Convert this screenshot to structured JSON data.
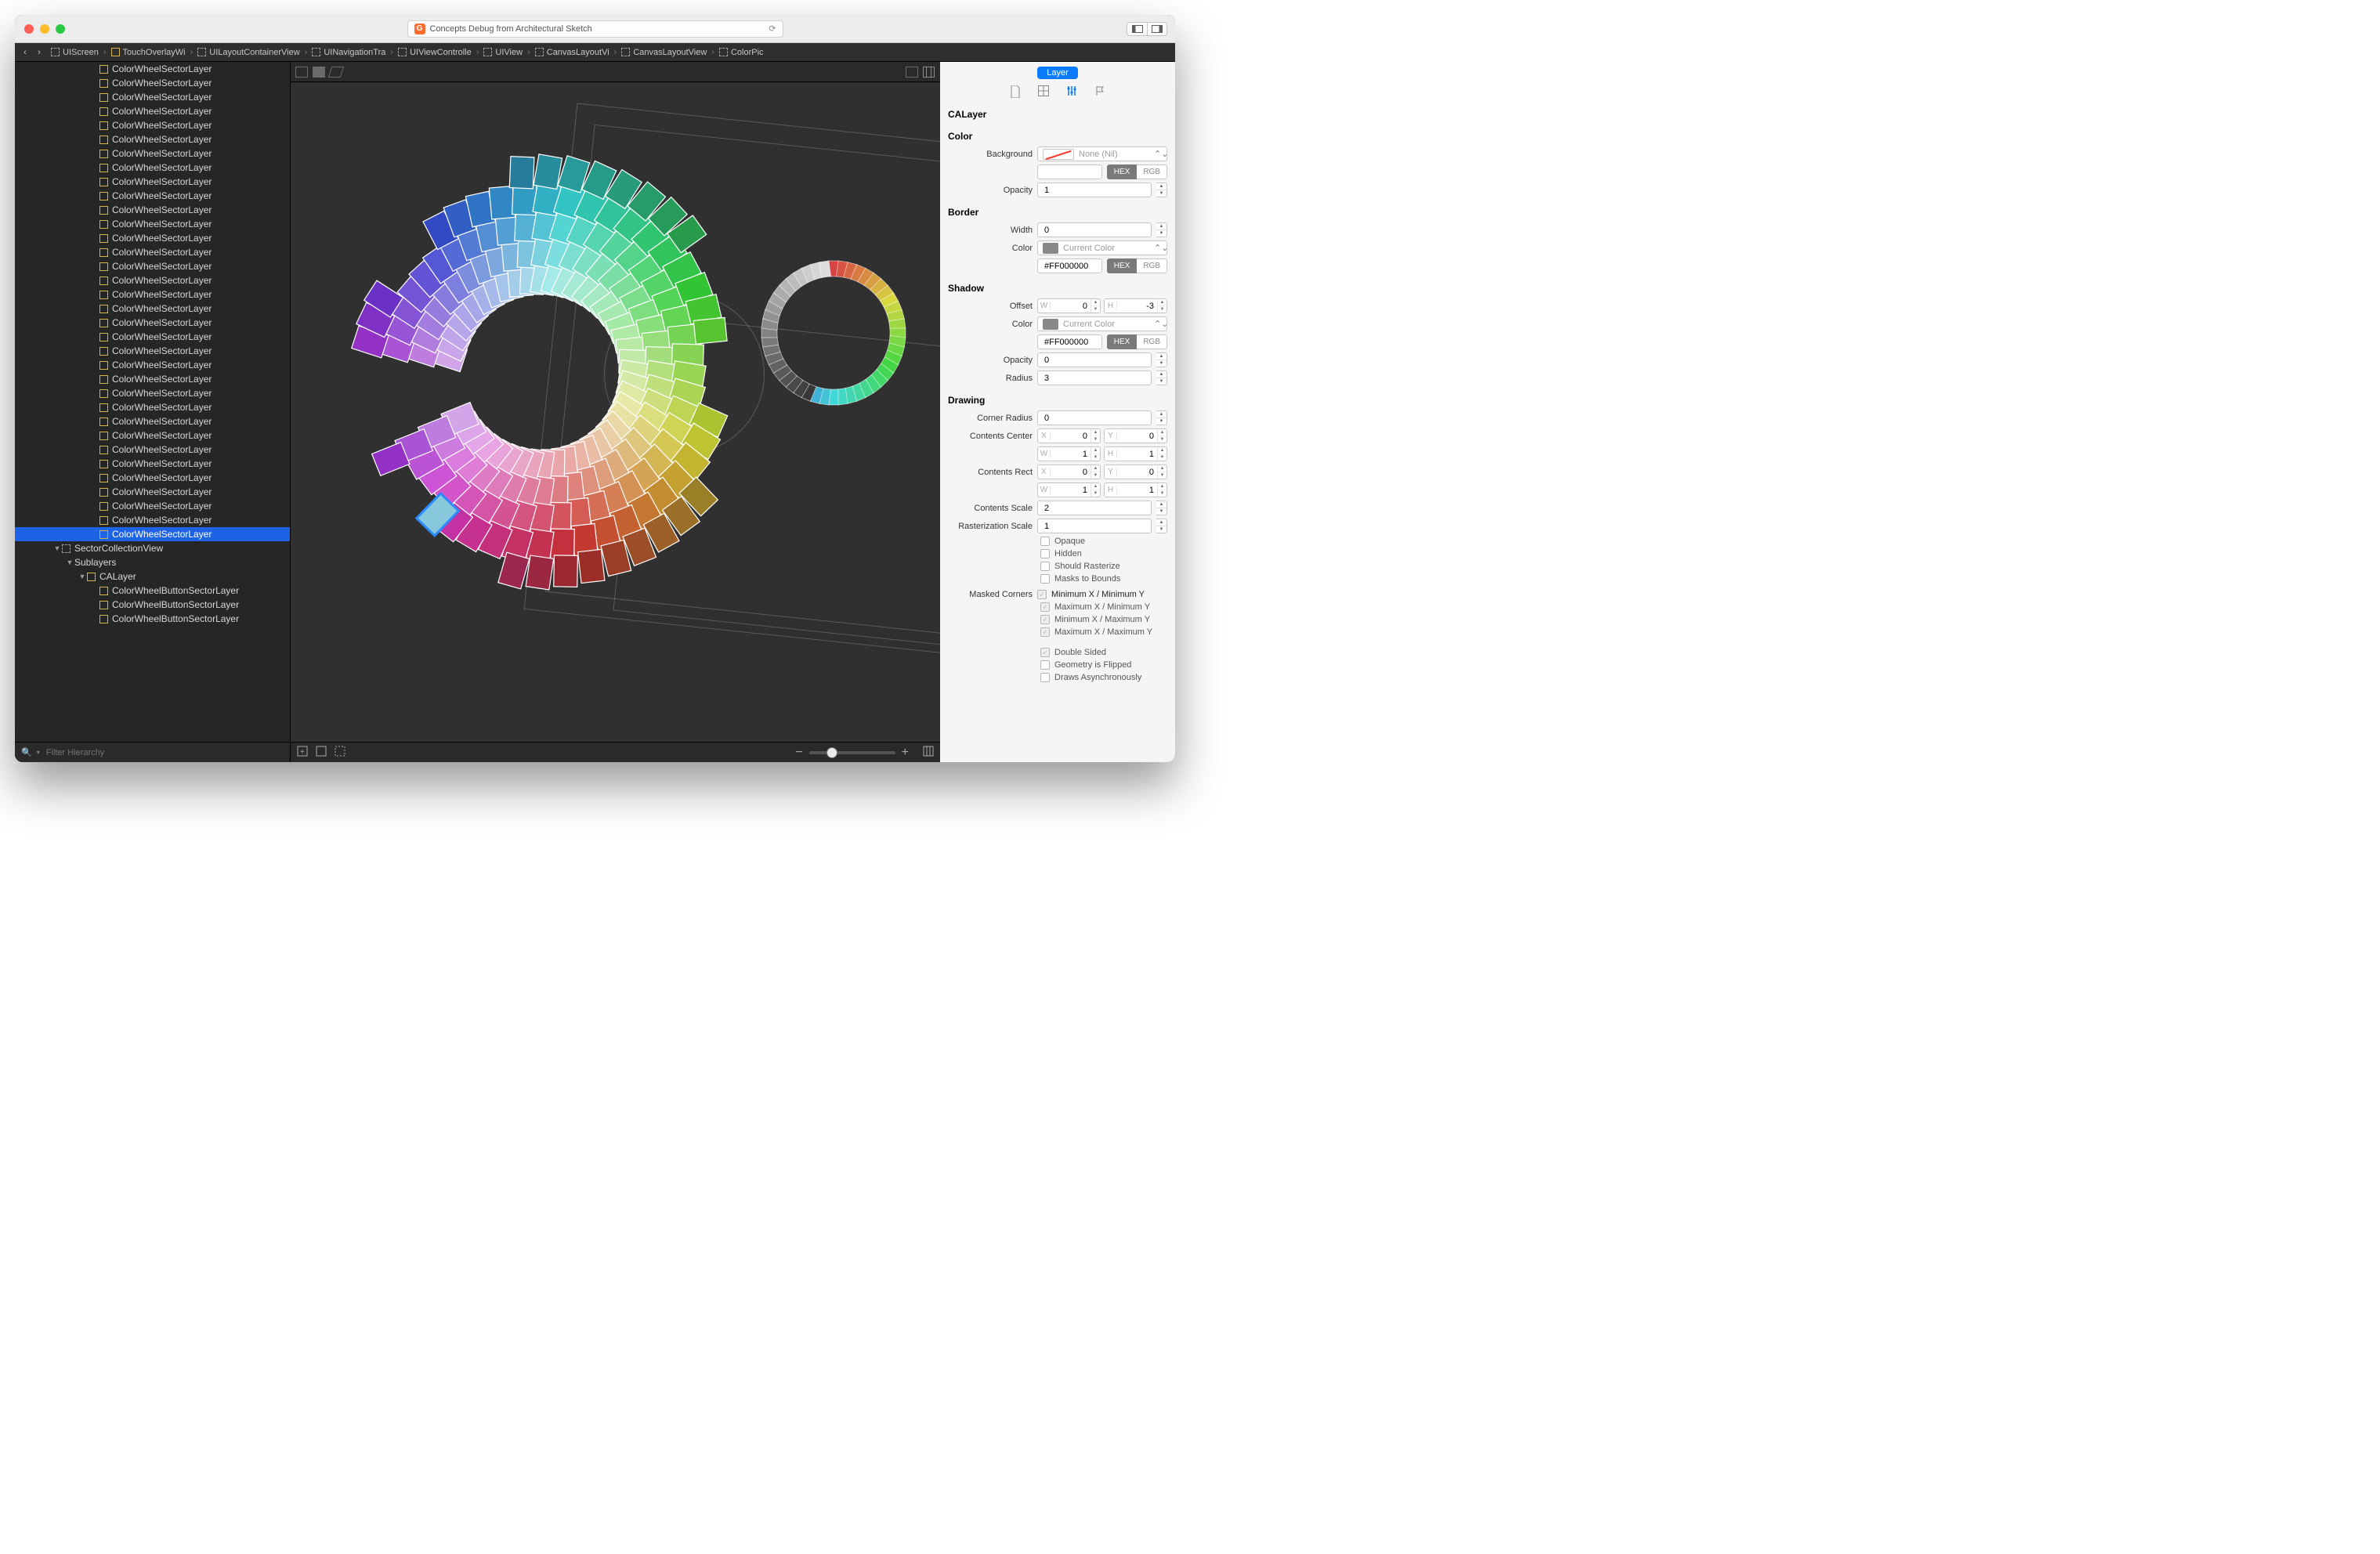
{
  "window": {
    "title": "Concepts Debug from Architectural Sketch",
    "appBadge": "G"
  },
  "breadcrumb": {
    "items": [
      {
        "label": "UIScreen",
        "icon": "dashed"
      },
      {
        "label": "TouchOverlayWi",
        "icon": "solid"
      },
      {
        "label": "UILayoutContainerView",
        "icon": "dashed"
      },
      {
        "label": "UINavigationTra",
        "icon": "dashed"
      },
      {
        "label": "UIViewControlle",
        "icon": "dashed"
      },
      {
        "label": "UIView",
        "icon": "dashed"
      },
      {
        "label": "CanvasLayoutVi",
        "icon": "dashed"
      },
      {
        "label": "CanvasLayoutView",
        "icon": "dashed"
      },
      {
        "label": "ColorPic",
        "icon": "dashed"
      }
    ]
  },
  "tree": {
    "selectedIndex": 33,
    "layerName": "ColorWheelSectorLayer",
    "layerCount": 34,
    "afterSelection": [
      {
        "indent": 3,
        "kind": "disclosure-open",
        "icon": "dashed",
        "label": "SectorCollectionView"
      },
      {
        "indent": 4,
        "kind": "disclosure-open",
        "icon": "none",
        "label": "Sublayers"
      },
      {
        "indent": 5,
        "kind": "disclosure-open",
        "icon": "solid",
        "label": "CALayer"
      },
      {
        "indent": 6,
        "kind": "leaf",
        "icon": "solid",
        "label": "ColorWheelButtonSectorLayer"
      },
      {
        "indent": 6,
        "kind": "leaf",
        "icon": "solid",
        "label": "ColorWheelButtonSectorLayer"
      },
      {
        "indent": 6,
        "kind": "leaf",
        "icon": "solid",
        "label": "ColorWheelButtonSectorLayer"
      }
    ]
  },
  "filter": {
    "placeholder": "Filter Hierarchy"
  },
  "inspector": {
    "pill": "Layer",
    "className": "CALayer",
    "sections": {
      "color": {
        "title": "Color",
        "background": {
          "label": "Background",
          "valueLabel": "None (Nil)",
          "hexSeg": "HEX",
          "rgbSeg": "RGB",
          "hexValue": ""
        },
        "opacity": {
          "label": "Opacity",
          "value": "1"
        }
      },
      "border": {
        "title": "Border",
        "width": {
          "label": "Width",
          "value": "0"
        },
        "color": {
          "label": "Color",
          "valueLabel": "Current Color",
          "hexValue": "#FF000000",
          "hexSeg": "HEX",
          "rgbSeg": "RGB"
        }
      },
      "shadow": {
        "title": "Shadow",
        "offset": {
          "label": "Offset",
          "w": "0",
          "h": "-3"
        },
        "color": {
          "label": "Color",
          "valueLabel": "Current Color",
          "hexValue": "#FF000000",
          "hexSeg": "HEX",
          "rgbSeg": "RGB"
        },
        "opacity": {
          "label": "Opacity",
          "value": "0"
        },
        "radius": {
          "label": "Radius",
          "value": "3"
        }
      },
      "drawing": {
        "title": "Drawing",
        "cornerRadius": {
          "label": "Corner Radius",
          "value": "0"
        },
        "contentsCenter": {
          "label": "Contents Center",
          "x": "0",
          "y": "0",
          "w": "1",
          "h": "1"
        },
        "contentsRect": {
          "label": "Contents Rect",
          "x": "0",
          "y": "0",
          "w": "1",
          "h": "1"
        },
        "contentsScale": {
          "label": "Contents Scale",
          "value": "2"
        },
        "rasterizationScale": {
          "label": "Rasterization Scale",
          "value": "1"
        },
        "checks": {
          "opaque": {
            "label": "Opaque",
            "on": false
          },
          "hidden": {
            "label": "Hidden",
            "on": false
          },
          "shouldRasterize": {
            "label": "Should Rasterize",
            "on": false
          },
          "masksToBounds": {
            "label": "Masks to Bounds",
            "on": false
          }
        },
        "maskedCorners": {
          "label": "Masked Corners",
          "minXminY": {
            "label": "Minimum X / Minimum Y",
            "on": true
          },
          "maxXminY": {
            "label": "Maximum X / Minimum Y",
            "on": true
          },
          "minXmaxY": {
            "label": "Minimum X / Maximum Y",
            "on": true
          },
          "maxXmaxY": {
            "label": "Maximum X / Maximum Y",
            "on": true
          }
        },
        "moreChecks": {
          "doubleSided": {
            "label": "Double Sided",
            "on": true
          },
          "geometryFlipped": {
            "label": "Geometry is Flipped",
            "on": false
          },
          "drawsAsync": {
            "label": "Draws Asynchronously",
            "on": false
          }
        }
      }
    }
  }
}
